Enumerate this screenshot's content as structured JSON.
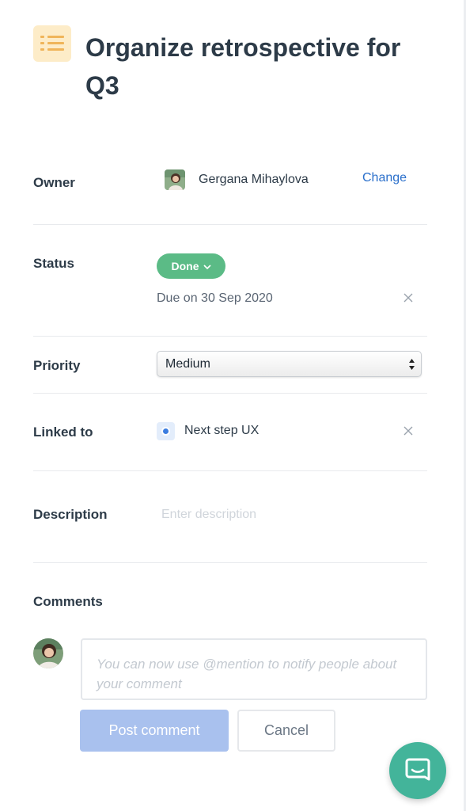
{
  "task": {
    "title": "Organize retrospective for Q3",
    "icon": "list-icon"
  },
  "owner": {
    "label": "Owner",
    "name": "Gergana Mihaylova",
    "change_label": "Change"
  },
  "status": {
    "label": "Status",
    "value": "Done",
    "due_text": "Due on 30 Sep 2020",
    "color": "#5bbb86"
  },
  "priority": {
    "label": "Priority",
    "value": "Medium"
  },
  "linked": {
    "label": "Linked to",
    "item": "Next step UX"
  },
  "description": {
    "label": "Description",
    "placeholder": "Enter description"
  },
  "comments": {
    "label": "Comments",
    "placeholder": "You can now use @mention to notify people about your comment",
    "post_label": "Post comment",
    "cancel_label": "Cancel"
  },
  "colors": {
    "accent": "#2a6fcb",
    "post_button": "#a9c1ee",
    "chat": "#43b49a"
  }
}
